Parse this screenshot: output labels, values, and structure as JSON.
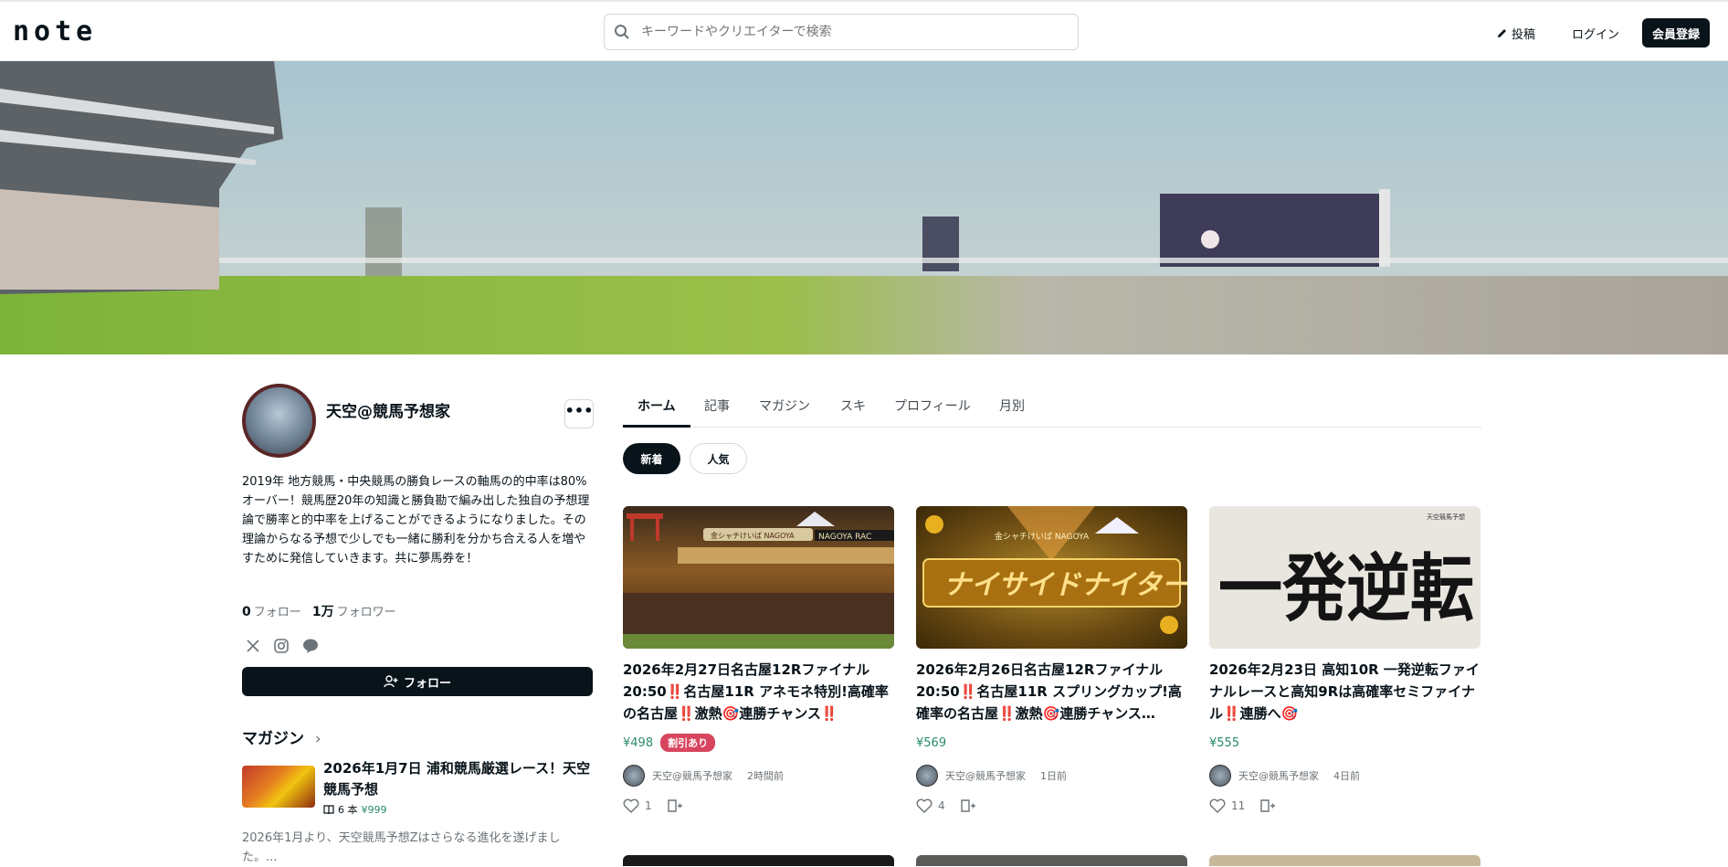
{
  "header": {
    "logo": "note",
    "search_placeholder": "キーワードやクリエイターで検索",
    "post_label": "投稿",
    "login_label": "ログイン",
    "signup_label": "会員登録"
  },
  "profile": {
    "name": "天空@競馬予想家",
    "more_label": "•••",
    "bio": "2019年 地方競馬・中央競馬の勝負レースの軸馬の的中率は80%オーバー！競馬歴20年の知識と勝負勘で編み出した独自の予想理論で勝率と的中率を上げることができるようになりました。その理論からなる予想で少しでも一緒に勝利を分かち合える人を増やすために発信していきます。共に夢馬券を！",
    "follow_count": "0",
    "follow_label": "フォロー",
    "follower_count": "1万",
    "follower_label": "フォロワー",
    "follow_button": "フォロー",
    "socials": [
      "x-icon",
      "instagram-icon",
      "line-icon"
    ]
  },
  "magazine": {
    "heading": "マガジン",
    "item_title": "2026年1月7日 浦和競馬厳選レース！天空競馬予想",
    "item_count": "6 本",
    "item_price": "¥999",
    "item_desc": "2026年1月より、天空競馬予想Zはさらなる進化を遂げました。..."
  },
  "tabs": [
    "ホーム",
    "記事",
    "マガジン",
    "スキ",
    "プロフィール",
    "月別"
  ],
  "filters": {
    "new": "新着",
    "popular": "人気"
  },
  "cards": [
    {
      "title": "2026年2月27日名古屋12Rファイナル20:50‼️名古屋11R アネモネ特別!高確率の名古屋‼️激熱🎯連勝チャンス‼️",
      "price": "¥498",
      "badge": "割引あり",
      "author": "天空@競馬予想家",
      "time": "2時間前",
      "likes": "1"
    },
    {
      "title": "2026年2月26日名古屋12Rファイナル20:50‼️名古屋11R スプリングカップ!高確率の名古屋‼️激熱🎯連勝チャンス…",
      "price": "¥569",
      "badge": "",
      "author": "天空@競馬予想家",
      "time": "1日前",
      "likes": "4"
    },
    {
      "title": "2026年2月23日 高知10R 一発逆転ファイナルレースと高知9Rは高確率セミファイナル‼️連勝へ🎯",
      "price": "¥555",
      "badge": "",
      "author": "天空@競馬予想家",
      "time": "4日前",
      "likes": "11"
    }
  ],
  "thumb_texts": {
    "card1_sign": "金シャチけいば NAGOYA",
    "card1_race": "NAGOYA RAC",
    "card2_sign": "金シャチけいば NAGOYA",
    "card2_main": "ナイサイドナイター",
    "card3_main": "一発逆転",
    "card3_small": "天空競馬予想"
  }
}
